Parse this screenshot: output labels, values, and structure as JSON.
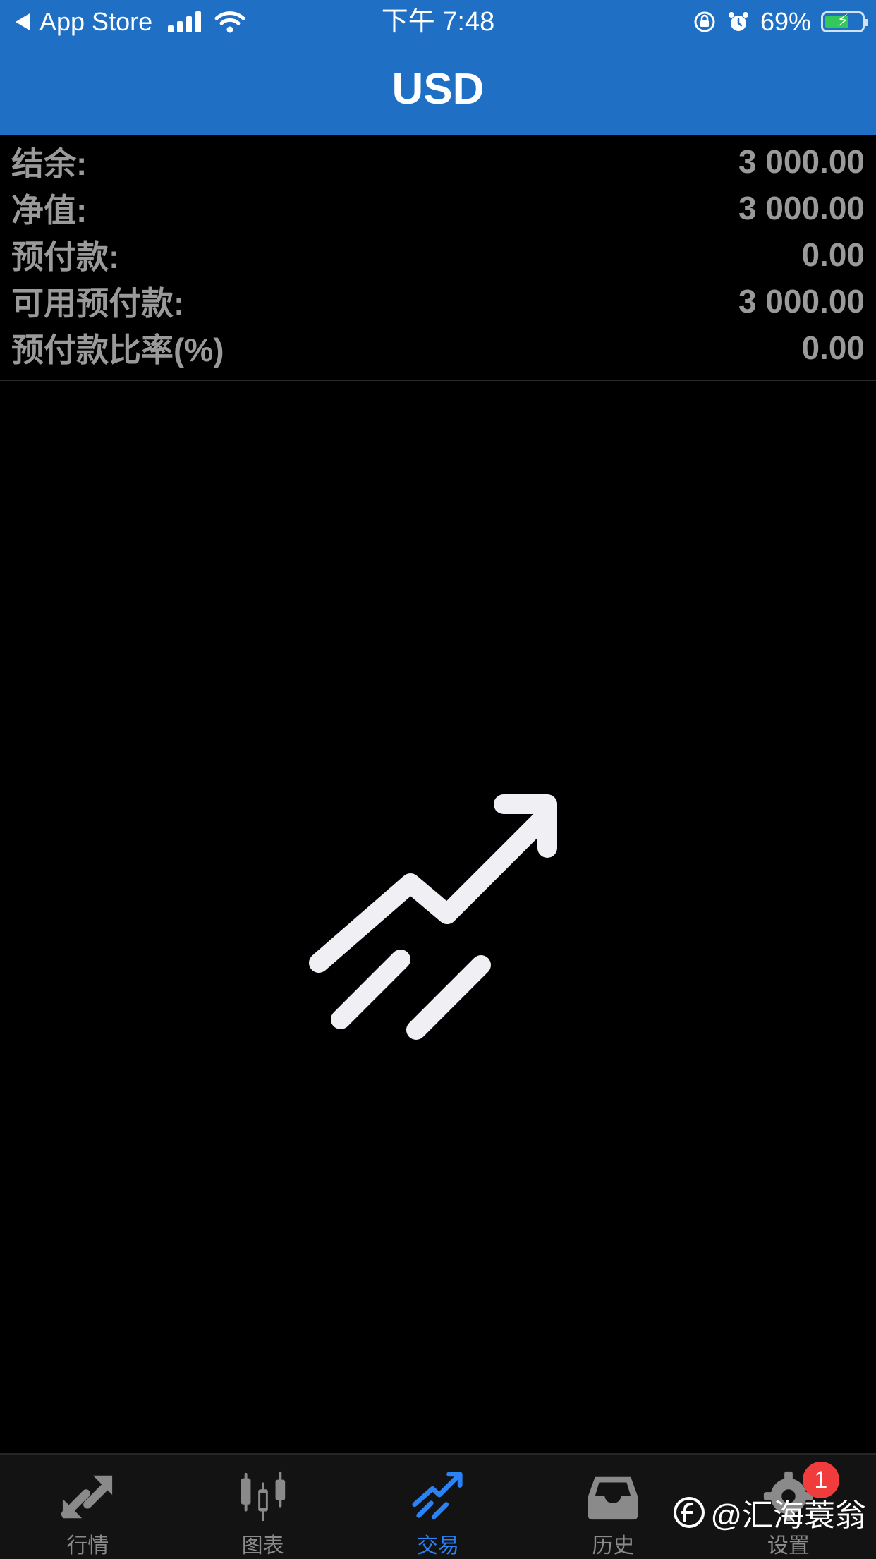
{
  "status_bar": {
    "back_label": "App Store",
    "time": "下午 7:48",
    "battery_percent": "69%",
    "battery_level": 0.69
  },
  "header": {
    "title": "USD"
  },
  "summary": {
    "rows": [
      {
        "label": "结余:",
        "value": "3 000.00"
      },
      {
        "label": "净值:",
        "value": "3 000.00"
      },
      {
        "label": "预付款:",
        "value": "0.00"
      },
      {
        "label": "可用预付款:",
        "value": "3 000.00"
      },
      {
        "label": "预付款比率(%)",
        "value": "0.00"
      }
    ]
  },
  "tabs": [
    {
      "label": "行情",
      "icon": "quotes-arrows-icon",
      "active": false
    },
    {
      "label": "图表",
      "icon": "candlestick-icon",
      "active": false
    },
    {
      "label": "交易",
      "icon": "trade-trend-icon",
      "active": true
    },
    {
      "label": "历史",
      "icon": "inbox-tray-icon",
      "active": false
    },
    {
      "label": "设置",
      "icon": "gear-icon",
      "active": false,
      "badge": "1"
    }
  ],
  "watermark": {
    "text": "@汇海蓑翁"
  },
  "colors": {
    "header_blue": "#1f6fc4",
    "active_tab": "#2a82f5",
    "badge_red": "#f03c3c"
  }
}
